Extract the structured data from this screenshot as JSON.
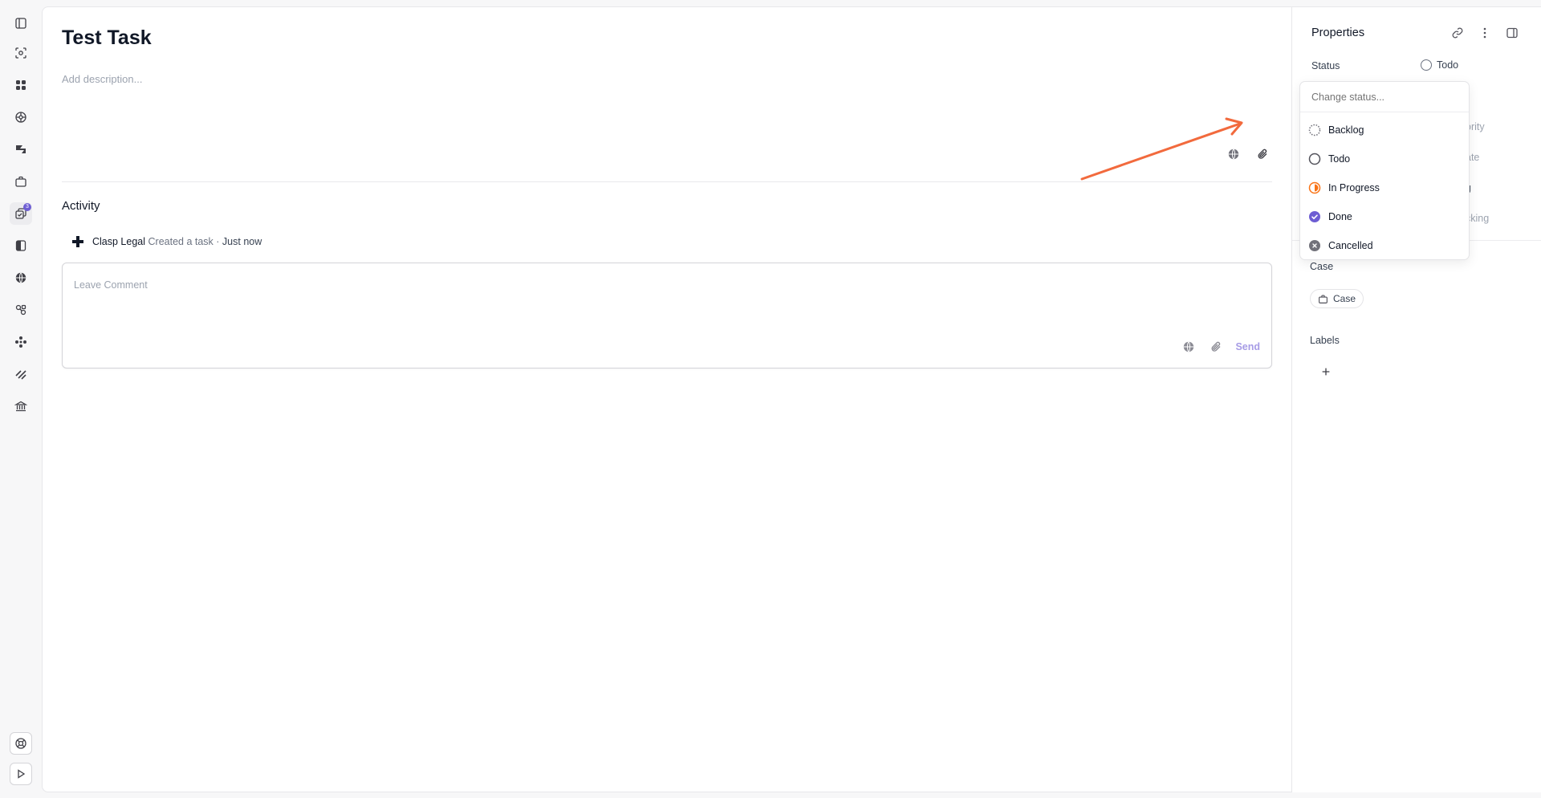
{
  "task": {
    "title": "Test Task",
    "description_placeholder": "Add description..."
  },
  "activity": {
    "heading": "Activity",
    "entries": [
      {
        "actor": "Clasp Legal",
        "action": "Created a task ·",
        "time": "Just now"
      }
    ],
    "comment_placeholder": "Leave Comment",
    "send_label": "Send"
  },
  "sidebar": {
    "badge_count": "3",
    "icons": [
      "sidebar-toggle-icon",
      "scan-icon",
      "dashboard-icon",
      "network-icon",
      "analytics-icon",
      "briefcase-icon",
      "tasks-icon",
      "document-icon",
      "globe-icon",
      "integrations-icon",
      "apps-icon",
      "flow-icon",
      "bank-icon",
      "support-icon",
      "play-icon"
    ]
  },
  "properties": {
    "title": "Properties",
    "status_label": "Status",
    "status_value": "Todo",
    "peek_priority": "ority",
    "peek_date": "ate",
    "peek_tag": "g",
    "peek_tracking": "cking",
    "case_label": "Case",
    "case_chip": "Case",
    "labels_label": "Labels"
  },
  "status_dropdown": {
    "search_placeholder": "Change status...",
    "options": [
      {
        "label": "Backlog",
        "icon": "backlog-icon"
      },
      {
        "label": "Todo",
        "icon": "todo-icon"
      },
      {
        "label": "In Progress",
        "icon": "in-progress-icon",
        "color": "#f97316"
      },
      {
        "label": "Done",
        "icon": "done-icon",
        "color": "#6d5dd3"
      },
      {
        "label": "Cancelled",
        "icon": "cancelled-icon",
        "color": "#71717a"
      }
    ]
  },
  "colors": {
    "accent": "#6d5dd3",
    "annotation_arrow": "#f26a3d",
    "send_disabled": "#a79ce6"
  }
}
